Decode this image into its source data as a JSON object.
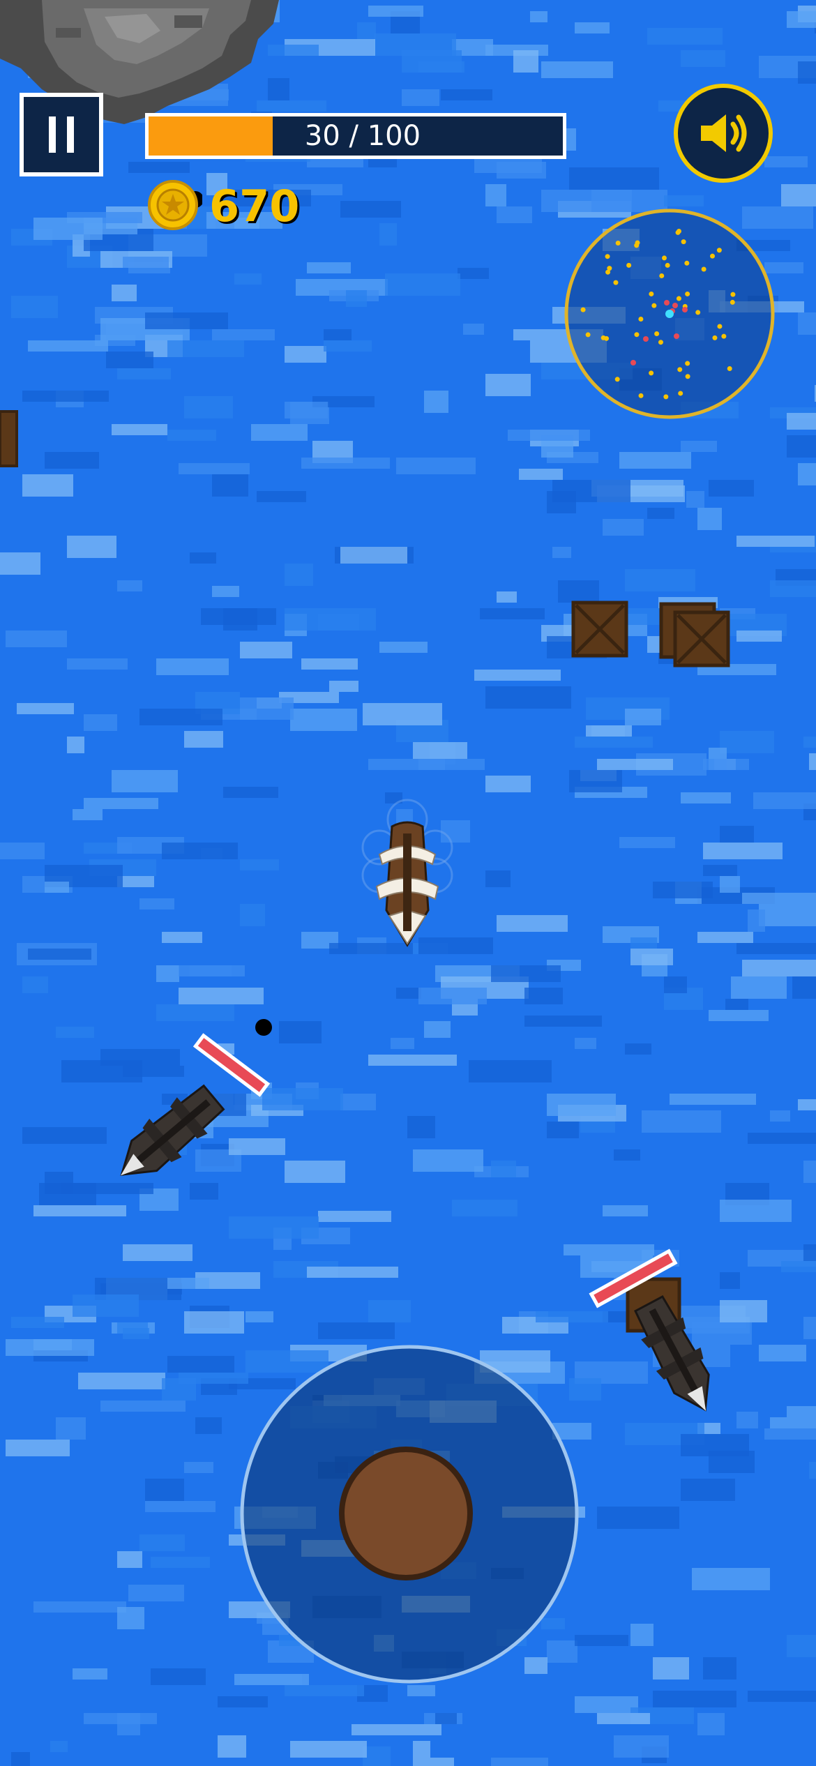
{
  "hud": {
    "health_text": "30 / 100",
    "health_fraction": 0.3,
    "coins": "670",
    "pause_icon": "pause-icon",
    "sound_icon": "speaker-icon",
    "coin_icon": "star-coin-icon"
  },
  "colors": {
    "ocean": "#1f74ec",
    "hud_panel": "#0d2547",
    "health_fill": "#fb9b0e",
    "coin_gold": "#f7c200",
    "minimap_border": "#e0b42a",
    "enemy_health": "#e84a55",
    "joystick_knob": "#7a4a2a"
  },
  "minimap": {
    "marker_colors": {
      "coin": "#f7c200",
      "enemy": "#e84a55",
      "player": "#40e0ff"
    }
  },
  "entities": {
    "player_ship": "player-ship",
    "enemy_ships": 2,
    "crates": 4,
    "cannonball": 1,
    "rock_island": 1
  }
}
